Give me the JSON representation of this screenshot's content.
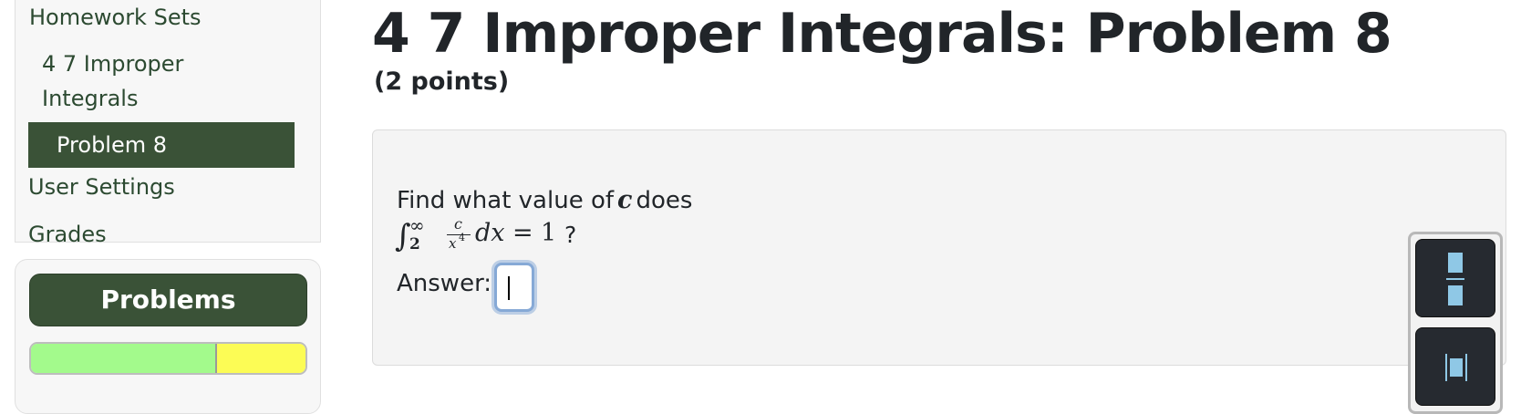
{
  "sidebar": {
    "nav_cut_label": "Homework Sets",
    "sub_item_label": "4 7 Improper Integrals",
    "active_item_label": "Problem 8",
    "user_settings_label": "User Settings",
    "grades_label": "Grades"
  },
  "problems_panel": {
    "button_label": "Problems",
    "progress": {
      "correct_fraction": 0.677,
      "partial_fraction": 0.323
    },
    "colors": {
      "correct": "#a3fa8c",
      "partial": "#fcfc55",
      "accent": "#3a5237"
    }
  },
  "main": {
    "title": "4 7 Improper Integrals: Problem 8",
    "points": "(2 points)",
    "question": {
      "prefix": "Find what value of",
      "variable": "c",
      "suffix": "does",
      "integral": {
        "integral_sign": "∫",
        "lower_limit": "2",
        "upper_limit": "∞",
        "numerator": "c",
        "denominator_base": "x",
        "denominator_exponent": "4",
        "differential": "dx",
        "equals": "=",
        "rhs": "1",
        "question_mark": "?"
      },
      "answer_label": "Answer:",
      "answer_value": ""
    }
  },
  "toolbar": {
    "buttons": [
      {
        "icon": "fraction-icon"
      },
      {
        "icon": "bracketed-box-icon"
      }
    ]
  }
}
